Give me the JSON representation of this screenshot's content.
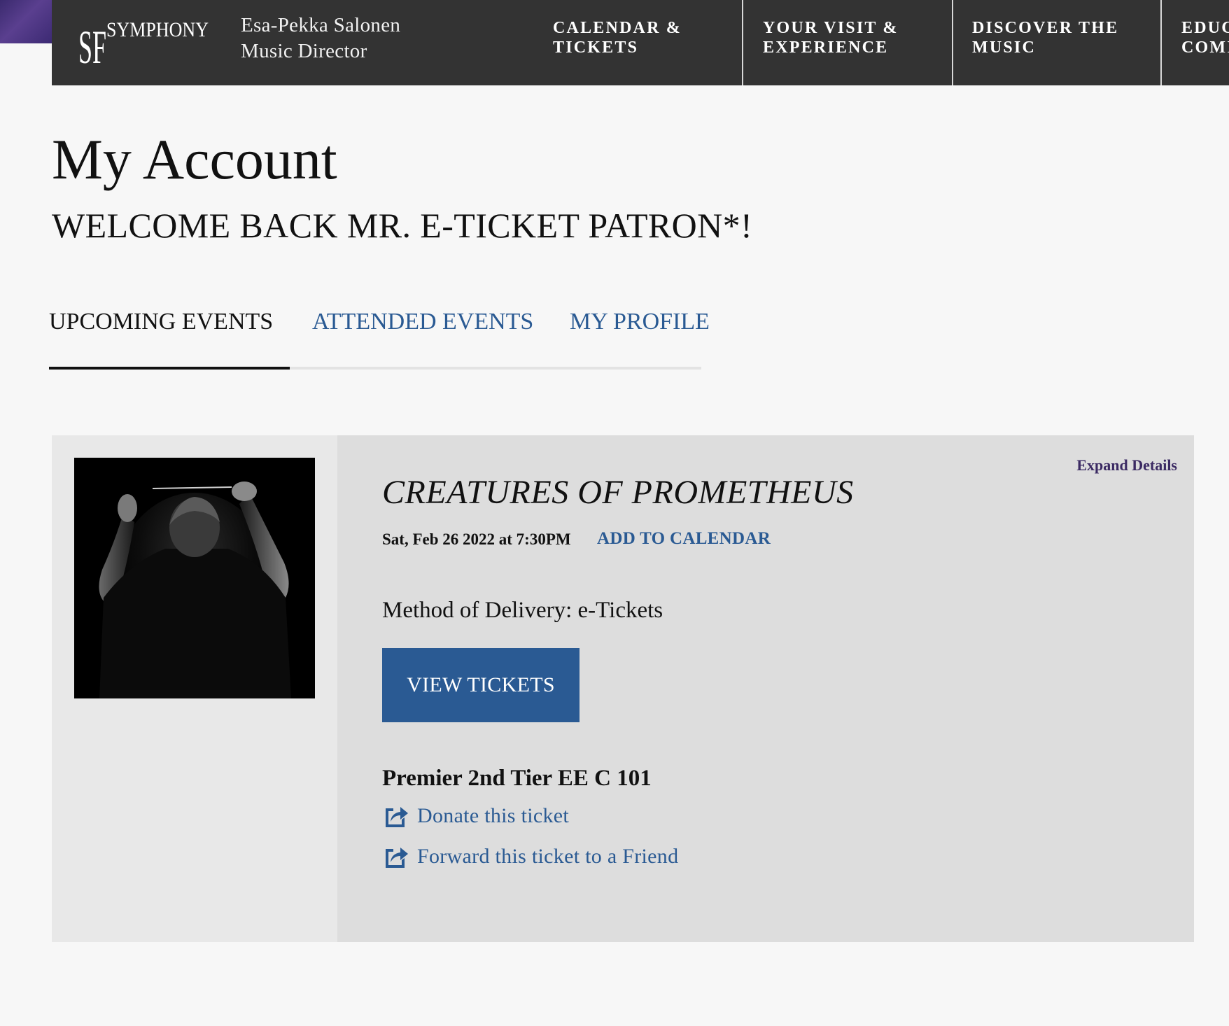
{
  "header": {
    "brand_primary": "SF",
    "brand_secondary": "SYMPHONY",
    "director_name": "Esa-Pekka Salonen",
    "director_title": "Music Director",
    "nav": [
      {
        "line1": "CALENDAR &",
        "line2": "TICKETS"
      },
      {
        "line1": "YOUR VISIT &",
        "line2": "EXPERIENCE"
      },
      {
        "line1": "DISCOVER THE",
        "line2": "MUSIC"
      },
      {
        "line1": "EDUC",
        "line2": "COMI"
      }
    ]
  },
  "page": {
    "title": "My Account",
    "welcome": "WELCOME BACK MR. E-TICKET PATRON*!"
  },
  "tabs": [
    {
      "label": "UPCOMING EVENTS",
      "active": true
    },
    {
      "label": "ATTENDED EVENTS",
      "active": false
    },
    {
      "label": "MY PROFILE",
      "active": false
    }
  ],
  "event": {
    "expand_label": "Expand Details",
    "title": "CREATURES OF PROMETHEUS",
    "date": "Sat, Feb 26 2022 at 7:30PM",
    "add_to_calendar": "ADD TO CALENDAR",
    "delivery": "Method of Delivery: e-Tickets",
    "view_tickets_label": "VIEW TICKETS",
    "seat": "Premier 2nd Tier EE C 101",
    "actions": [
      {
        "label": "Donate this ticket",
        "icon": "share-icon"
      },
      {
        "label": "Forward this ticket to a Friend",
        "icon": "share-icon"
      }
    ],
    "image_alt": "conductor-photo"
  },
  "colors": {
    "topbar": "#333333",
    "link_blue": "#2a5a93",
    "button_blue": "#2a5a93",
    "expand_purple": "#3b2a63",
    "card_bg": "#dddddd",
    "card_left_bg": "#e8e8e8",
    "page_bg": "#f7f7f7"
  }
}
